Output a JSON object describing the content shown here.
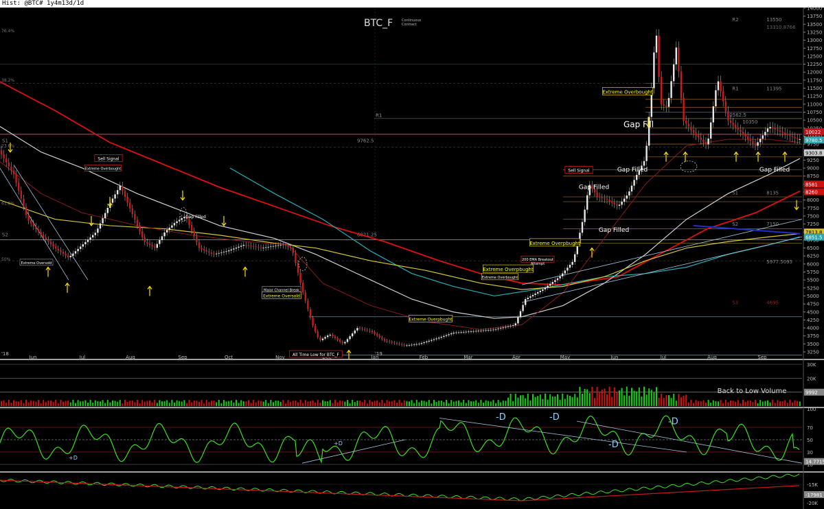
{
  "window_title": "Hist: @BTC# 1y4m13d/1d",
  "chart_data": {
    "type": "candlestick",
    "symbol": "BTC_F",
    "subtitle": "Continuous Contract",
    "year_start": "'18",
    "year_mid": "'19",
    "x_month_labels": [
      "Jun",
      "Jul",
      "Aug",
      "Sep",
      "Oct",
      "Nov",
      "Dec",
      "Jan",
      "Feb",
      "Mar",
      "Apr",
      "May",
      "Jun",
      "Jul",
      "Aug",
      "Sep"
    ],
    "price_axis_ticks": [
      3250,
      3500,
      3750,
      4000,
      4250,
      4500,
      4750,
      5000,
      5250,
      5500,
      5750,
      6000,
      6250,
      6500,
      6750,
      7000,
      7250,
      7500,
      7750,
      8000,
      8250,
      8500,
      8750,
      9000,
      9250,
      9500,
      9750,
      10000,
      10250,
      10500,
      10750,
      11000,
      11250,
      11500,
      11750,
      12000,
      12250,
      12500,
      12750,
      13000,
      13250,
      13500,
      13750,
      14000
    ],
    "ylim": [
      3100,
      14000
    ],
    "price_tags": [
      {
        "text": "10022",
        "value": 10140,
        "bg": "#cc1111",
        "fg": "#fff"
      },
      {
        "text": "9780.5",
        "value": 9880,
        "bg": "#2aa7b0",
        "fg": "#fff"
      },
      {
        "text": "9303.8",
        "value": 9480,
        "bg": "#cfcfcf",
        "fg": "#000"
      },
      {
        "text": "8581",
        "value": 8500,
        "bg": "#cc1111",
        "fg": "#fff"
      },
      {
        "text": "8260",
        "value": 8260,
        "bg": "#cc1111",
        "fg": "#fff"
      },
      {
        "text": "7813.8",
        "value": 7000,
        "bg": "#e0c020",
        "fg": "#000"
      },
      {
        "text": "6851.5",
        "value": 6840,
        "bg": "#2aa7b0",
        "fg": "#fff"
      }
    ],
    "pivot_levels": [
      {
        "label": "R2",
        "text": "13550",
        "value": 13550,
        "x1": 0.93,
        "color": "#888"
      },
      {
        "label": "",
        "text": "13310.8766",
        "value": 13310,
        "x1": 0.93,
        "color": "#666"
      },
      {
        "label": "R1",
        "text": "11395",
        "value": 11395,
        "x1": 0.93,
        "color": "#888"
      },
      {
        "label": "",
        "text": "10562.5",
        "value": 10562,
        "x1": 0.88,
        "color": "#888"
      },
      {
        "label": "",
        "text": "10350",
        "value": 10350,
        "x1": 0.9,
        "color": "#888"
      },
      {
        "label": "S1",
        "text": "9762.5",
        "value": 9762,
        "x1": 0.0,
        "color": "#888"
      },
      {
        "label": "S1",
        "text": "8135",
        "value": 8135,
        "x1": 0.93,
        "color": "#888"
      },
      {
        "label": "S2",
        "text": "6821.25",
        "value": 6821,
        "x1": 0.0,
        "color": "#888"
      },
      {
        "label": "S2",
        "text": "7150",
        "value": 7150,
        "x1": 0.93,
        "color": "#888"
      },
      {
        "label": "",
        "text": "5977.5095",
        "value": 5977,
        "x1": 0.93,
        "color": "#888"
      },
      {
        "label": "S3",
        "text": "4695",
        "value": 4695,
        "x1": 0.93,
        "color": "#8a2222"
      }
    ],
    "fib_labels": [
      {
        "text": "76.4%",
        "value": 13250
      },
      {
        "text": "38.2%",
        "value": 11700
      },
      {
        "text": "23.6%",
        "value": 9650
      },
      {
        "text": "61.8%",
        "value": 7850
      },
      {
        "text": "50%",
        "value": 6100
      }
    ],
    "horizontal_levels": [
      12250,
      11650,
      11150,
      10900,
      10750,
      10550,
      10250,
      9750,
      9350,
      8950,
      8750,
      8100,
      7950,
      7400,
      7100,
      6650,
      4350,
      3150
    ],
    "annotations": [
      {
        "text": "Sell Signal",
        "x": 158,
        "value": 9250,
        "box": "#d22",
        "color": "#fff",
        "size": 6
      },
      {
        "text": "Extreme Overbought",
        "x": 150,
        "value": 8950,
        "box": "#d22",
        "color": "#fff",
        "size": 5
      },
      {
        "text": "Extreme Oversold",
        "x": 53,
        "value": 6000,
        "box": "#888",
        "color": "#fff",
        "size": 5
      },
      {
        "text": "Gap Filled",
        "x": 285,
        "value": 7430,
        "box": "",
        "color": "#fff",
        "size": 6
      },
      {
        "text": "Major Channel Break",
        "x": 410,
        "value": 5150,
        "box": "#888",
        "color": "#fff",
        "size": 5
      },
      {
        "text": "Extreme Oversold",
        "x": 410,
        "value": 4960,
        "box": "#e8c800",
        "color": "#ff0",
        "size": 6
      },
      {
        "text": "All Time Low for BTC_F",
        "x": 460,
        "value": 3120,
        "box": "#d22",
        "color": "#fff",
        "size": 6
      },
      {
        "text": "Extreme Overpbught",
        "x": 627,
        "value": 4230,
        "box": "#e8c800",
        "color": "#ff0",
        "size": 6
      },
      {
        "text": "Extreme Overbought",
        "x": 728,
        "value": 5550,
        "box": "#e8c800",
        "color": "#fff",
        "size": 5
      },
      {
        "text": "Extreme Overpbught",
        "x": 740,
        "value": 5780,
        "box": "#e8c800",
        "color": "#ff0",
        "size": 7
      },
      {
        "text": "200 EMA Breakout",
        "x": 783,
        "value": 6100,
        "box": "#d22",
        "color": "#fff",
        "size": 5
      },
      {
        "text": "Attempt",
        "x": 783,
        "value": 5970,
        "box": "",
        "color": "#fff",
        "size": 5
      },
      {
        "text": "Extreme Overpbught",
        "x": 808,
        "value": 6600,
        "box": "#e8c800",
        "color": "#ff0",
        "size": 7
      },
      {
        "text": "Sell Signal",
        "x": 843,
        "value": 8880,
        "box": "#d22",
        "color": "#fff",
        "size": 6
      },
      {
        "text": "Gap Filled",
        "x": 865,
        "value": 8350,
        "box": "",
        "color": "#fff",
        "size": 9
      },
      {
        "text": "Gap Filled",
        "x": 921,
        "value": 8890,
        "box": "",
        "color": "#fff",
        "size": 9
      },
      {
        "text": "Gap Filled",
        "x": 894,
        "value": 7000,
        "box": "",
        "color": "#fff",
        "size": 9
      },
      {
        "text": "Extreme Overbought",
        "x": 914,
        "value": 11330,
        "box": "#e8c800",
        "color": "#ff0",
        "size": 7
      },
      {
        "text": "Gap Fill",
        "x": 930,
        "value": 10280,
        "box": "",
        "color": "#fff",
        "size": 12
      },
      {
        "text": "Gap Filled",
        "x": 1128,
        "value": 8890,
        "box": "",
        "color": "#fff",
        "size": 9
      }
    ],
    "volume_axis_ticks": [
      "30K",
      "20K",
      "10K"
    ],
    "volume_last": "9992",
    "volume_note": "Back to Low Volume",
    "rsi_axis_ticks": [
      100,
      70,
      50,
      30,
      10
    ],
    "rsi_last": "14.7715",
    "rsi_notes": [
      {
        "text": "+D",
        "x": 100,
        "value": 18,
        "size": 8
      },
      {
        "text": "+D",
        "x": 486,
        "value": 41,
        "size": 8
      },
      {
        "text": "-D",
        "x": 722,
        "value": 82,
        "size": 13
      },
      {
        "text": "-D",
        "x": 800,
        "value": 82,
        "size": 13
      },
      {
        "text": "-D",
        "x": 886,
        "value": 38,
        "size": 13
      },
      {
        "text": "-D",
        "x": 973,
        "value": 75,
        "size": 13
      }
    ],
    "obv_axis_ticks": [
      "-15K",
      "-20K"
    ],
    "obv_last": "-17981"
  }
}
